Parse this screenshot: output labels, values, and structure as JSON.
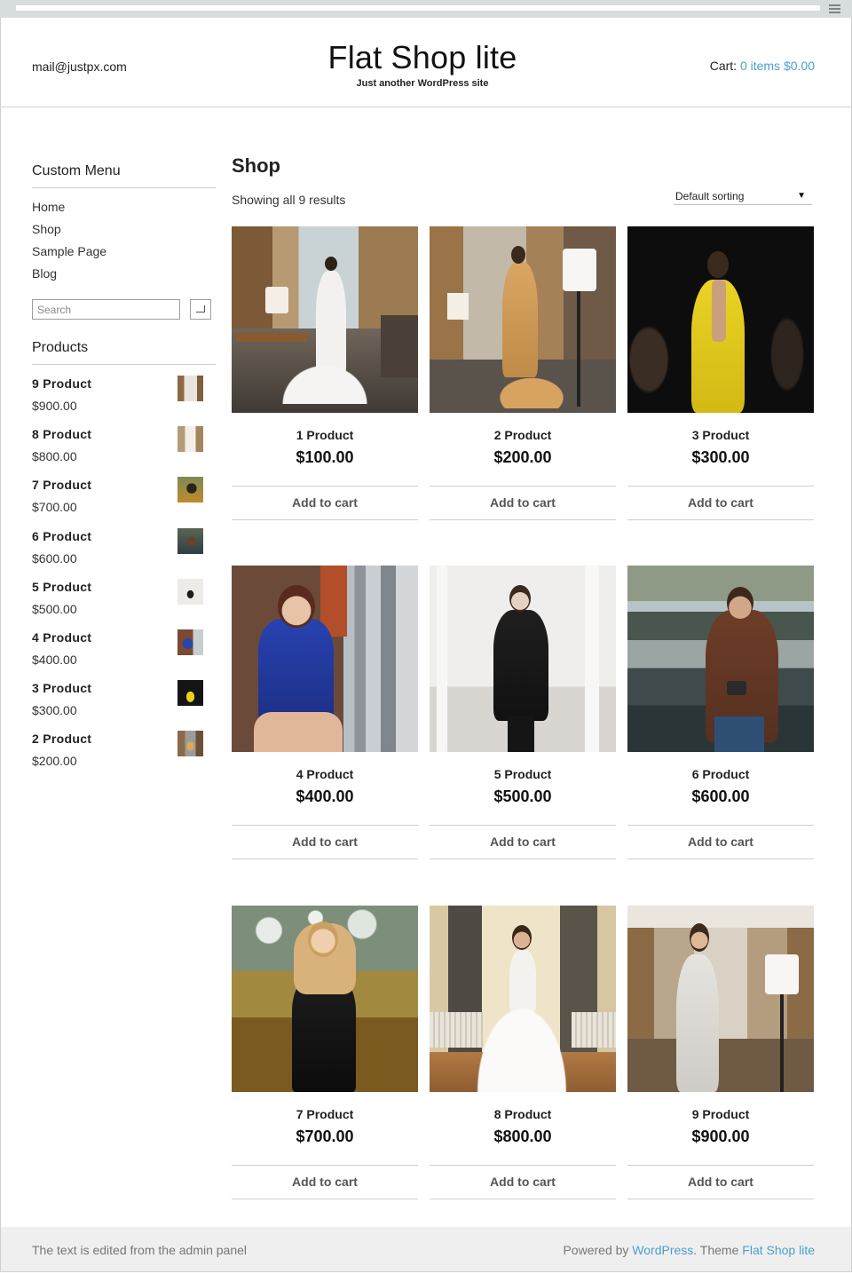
{
  "header": {
    "email": "mail@justpx.com",
    "site_title": "Flat Shop lite",
    "tagline": "Just another WordPress site",
    "cart_label": "Cart:",
    "cart_link": "0 items $0.00"
  },
  "sidebar": {
    "menu_title": "Custom Menu",
    "menu_items": [
      "Home",
      "Shop",
      "Sample Page",
      "Blog"
    ],
    "search_placeholder": "Search",
    "products_title": "Products",
    "products": [
      {
        "name": "9 Product",
        "price": "$900.00"
      },
      {
        "name": "8 Product",
        "price": "$800.00"
      },
      {
        "name": "7 Product",
        "price": "$700.00"
      },
      {
        "name": "6 Product",
        "price": "$600.00"
      },
      {
        "name": "5 Product",
        "price": "$500.00"
      },
      {
        "name": "4 Product",
        "price": "$400.00"
      },
      {
        "name": "3 Product",
        "price": "$300.00"
      },
      {
        "name": "2 Product",
        "price": "$200.00"
      }
    ]
  },
  "main": {
    "title": "Shop",
    "result_count": "Showing all 9 results",
    "sorting": "Default sorting",
    "add_to_cart": "Add to cart",
    "products": [
      {
        "name": "1 Product",
        "price": "$100.00"
      },
      {
        "name": "2 Product",
        "price": "$200.00"
      },
      {
        "name": "3 Product",
        "price": "$300.00"
      },
      {
        "name": "4 Product",
        "price": "$400.00"
      },
      {
        "name": "5 Product",
        "price": "$500.00"
      },
      {
        "name": "6 Product",
        "price": "$600.00"
      },
      {
        "name": "7 Product",
        "price": "$700.00"
      },
      {
        "name": "8 Product",
        "price": "$800.00"
      },
      {
        "name": "9 Product",
        "price": "$900.00"
      }
    ]
  },
  "footer": {
    "left_text": "The text is edited from the admin panel",
    "powered_prefix": "Powered by",
    "powered_link": "WordPress",
    "theme_prefix": ". Theme",
    "theme_link": "Flat Shop lite"
  },
  "colors": {
    "link": "#4aa0d0",
    "footer_bg": "#efefef",
    "admin_strip": "#d7dcdd"
  }
}
